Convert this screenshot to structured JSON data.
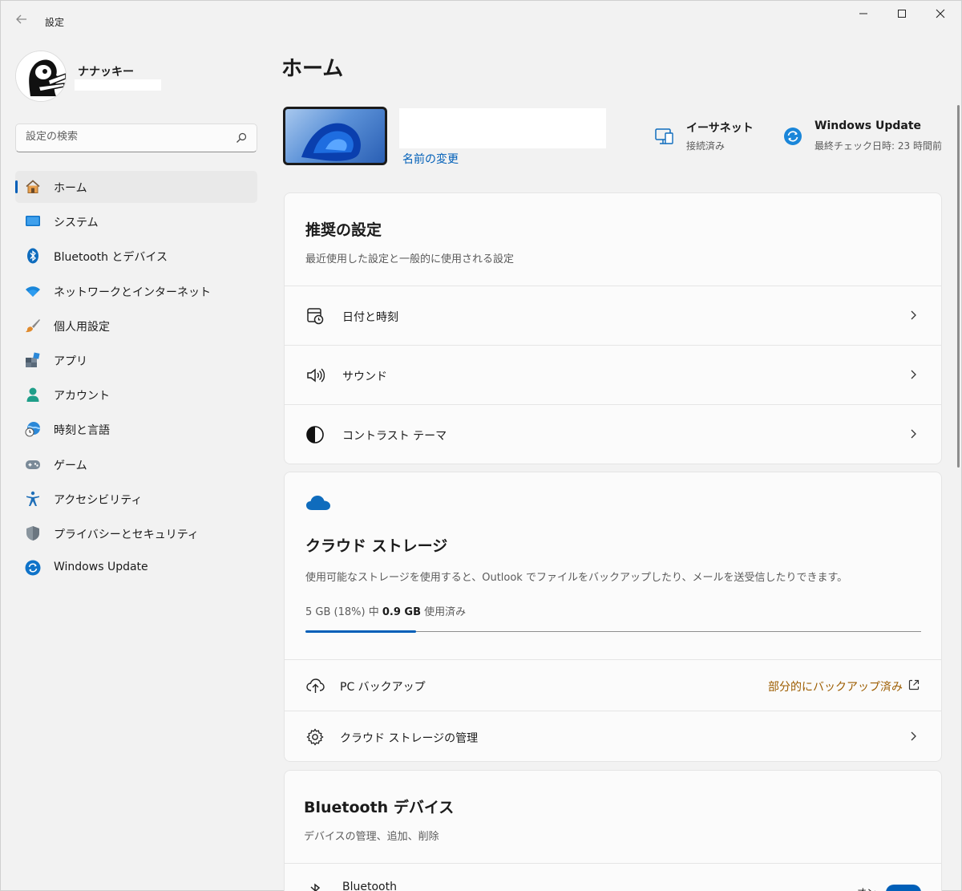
{
  "window": {
    "title": "設定",
    "back_icon": "back-arrow-icon",
    "minimize_glyph": "—",
    "maximize_glyph": "☐",
    "close_glyph": "✕"
  },
  "profile": {
    "name": "ナナッキー"
  },
  "search": {
    "placeholder": "設定の検索"
  },
  "sidebar": {
    "items": [
      {
        "label": "ホーム",
        "icon": "home-icon",
        "active": true
      },
      {
        "label": "システム",
        "icon": "system-icon"
      },
      {
        "label": "Bluetooth とデバイス",
        "icon": "bluetooth-icon"
      },
      {
        "label": "ネットワークとインターネット",
        "icon": "wifi-icon"
      },
      {
        "label": "個人用設定",
        "icon": "brush-icon"
      },
      {
        "label": "アプリ",
        "icon": "apps-icon"
      },
      {
        "label": "アカウント",
        "icon": "account-icon"
      },
      {
        "label": "時刻と言語",
        "icon": "time-language-icon"
      },
      {
        "label": "ゲーム",
        "icon": "gamepad-icon"
      },
      {
        "label": "アクセシビリティ",
        "icon": "accessibility-icon"
      },
      {
        "label": "プライバシーとセキュリティ",
        "icon": "shield-icon"
      },
      {
        "label": "Windows Update",
        "icon": "windows-update-icon"
      }
    ]
  },
  "main": {
    "title": "ホーム",
    "rename_link": "名前の変更",
    "ethernet": {
      "title": "イーサネット",
      "status": "接続済み"
    },
    "update": {
      "title": "Windows Update",
      "status": "最終チェック日時: 23 時間前"
    },
    "recommended": {
      "title": "推奨の設定",
      "subtitle": "最近使用した設定と一般的に使用される設定",
      "rows": [
        {
          "label": "日付と時刻",
          "icon": "clock-calendar-icon"
        },
        {
          "label": "サウンド",
          "icon": "speaker-icon"
        },
        {
          "label": "コントラスト テーマ",
          "icon": "contrast-icon"
        }
      ]
    },
    "cloud": {
      "title": "クラウド ストレージ",
      "subtitle": "使用可能なストレージを使用すると、Outlook でファイルをバックアップしたり、メールを送受信したりできます。",
      "usage_prefix": "5 GB (18%) 中 ",
      "usage_used": "0.9 GB",
      "usage_suffix": " 使用済み",
      "usage_fraction": 0.18,
      "rows": [
        {
          "label": "PC バックアップ",
          "icon": "cloud-upload-icon",
          "status": "部分的にバックアップ済み"
        },
        {
          "label": "クラウド ストレージの管理",
          "icon": "gear-icon"
        }
      ]
    },
    "bluetooth": {
      "title": "Bluetooth デバイス",
      "subtitle": "デバイスの管理、追加、削除",
      "row_label": "Bluetooth",
      "toggle_label": "オン"
    }
  },
  "colors": {
    "accent": "#005fb8",
    "warning_link": "#9d5d00"
  }
}
